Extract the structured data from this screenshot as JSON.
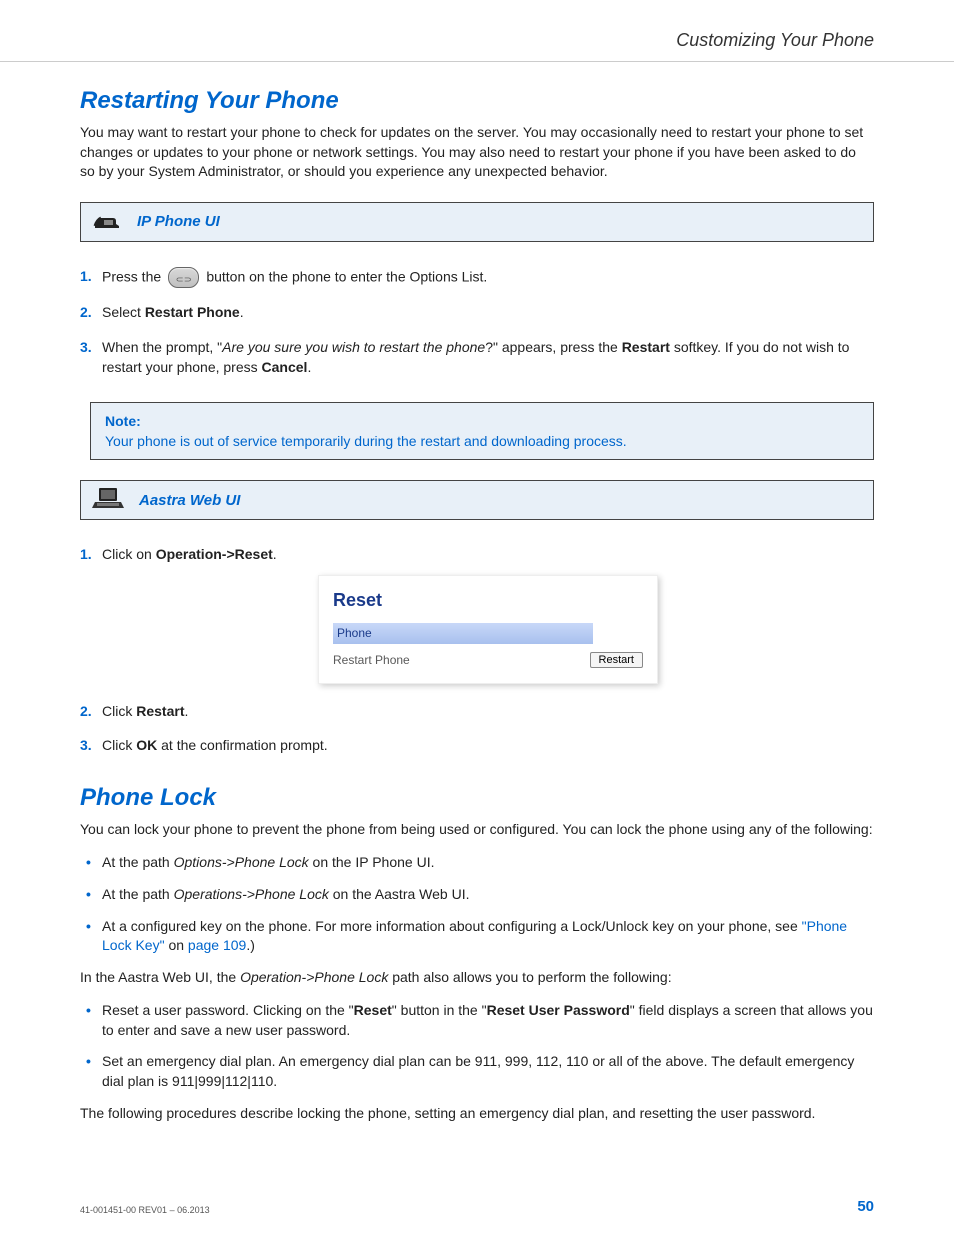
{
  "header": {
    "breadcrumb": "Customizing Your Phone"
  },
  "sect1": {
    "title": "Restarting Your Phone",
    "intro": "You may want to restart your phone to check for updates on the server. You may occasionally need to restart your phone to set changes or updates to your phone or network settings.   You may also need to restart your phone if you have been asked to do so by your System Administrator, or should you experience any unexpected behavior."
  },
  "uibox1": {
    "title": "IP Phone UI"
  },
  "steps1": {
    "s1_a": "Press the ",
    "s1_b": " button on the phone to enter the Options List.",
    "s2_a": "Select ",
    "s2_b": "Restart Phone",
    "s2_c": ".",
    "s3_a": "When the prompt, \"",
    "s3_b": "Are you sure you wish to restart the phone",
    "s3_c": "?\" appears, press the ",
    "s3_d": "Restart",
    "s3_e": " softkey. If you do not wish to restart your phone, press ",
    "s3_f": "Cancel",
    "s3_g": "."
  },
  "note": {
    "label": "Note:",
    "body": "Your phone is out of service temporarily during the restart and downloading process."
  },
  "uibox2": {
    "title": "Aastra Web UI"
  },
  "steps2": {
    "s1_a": "Click on ",
    "s1_b": "Operation->Reset",
    "s1_c": ".",
    "s2_a": "Click ",
    "s2_b": "Restart",
    "s2_c": ".",
    "s3_a": "Click ",
    "s3_b": "OK",
    "s3_c": " at the confirmation prompt."
  },
  "resetPanel": {
    "title": "Reset",
    "sub": "Phone",
    "rowLabel": "Restart Phone",
    "button": "Restart"
  },
  "sect2": {
    "title": "Phone Lock",
    "intro": "You can lock your phone to prevent the phone from being used or configured. You can lock the phone using any of the following:"
  },
  "bullets1": {
    "b1_a": "At the path ",
    "b1_b": "Options->Phone Lock",
    "b1_c": " on the IP Phone UI.",
    "b2_a": "At the path ",
    "b2_b": "Operations->Phone Lock",
    "b2_c": " on the Aastra Web UI.",
    "b3_a": "At a configured key on the phone. For more information about configuring a Lock/Unlock key on your phone, see ",
    "b3_b": "\"Phone Lock Key\"",
    "b3_c": " on ",
    "b3_d": "page 109",
    "b3_e": ".)"
  },
  "para2": {
    "a": "In the Aastra Web UI, the ",
    "b": "Operation->Phone Lock",
    "c": " path also allows you to perform the following:"
  },
  "bullets2": {
    "b1_a": "Reset a user password. Clicking on the \"",
    "b1_b": "Reset",
    "b1_c": "\" button in the \"",
    "b1_d": "Reset User Password",
    "b1_e": "\" field displays a screen that allows you to enter and save a new user password.",
    "b2": "Set an emergency dial plan. An emergency dial plan can be 911, 999, 112, 110 or all of the above. The default emergency dial plan is 911|999|112|110."
  },
  "para3": "The following procedures describe locking the phone, setting an emergency dial plan, and resetting the user password.",
  "footer": {
    "left": "41-001451-00 REV01 – 06.2013",
    "page": "50"
  }
}
